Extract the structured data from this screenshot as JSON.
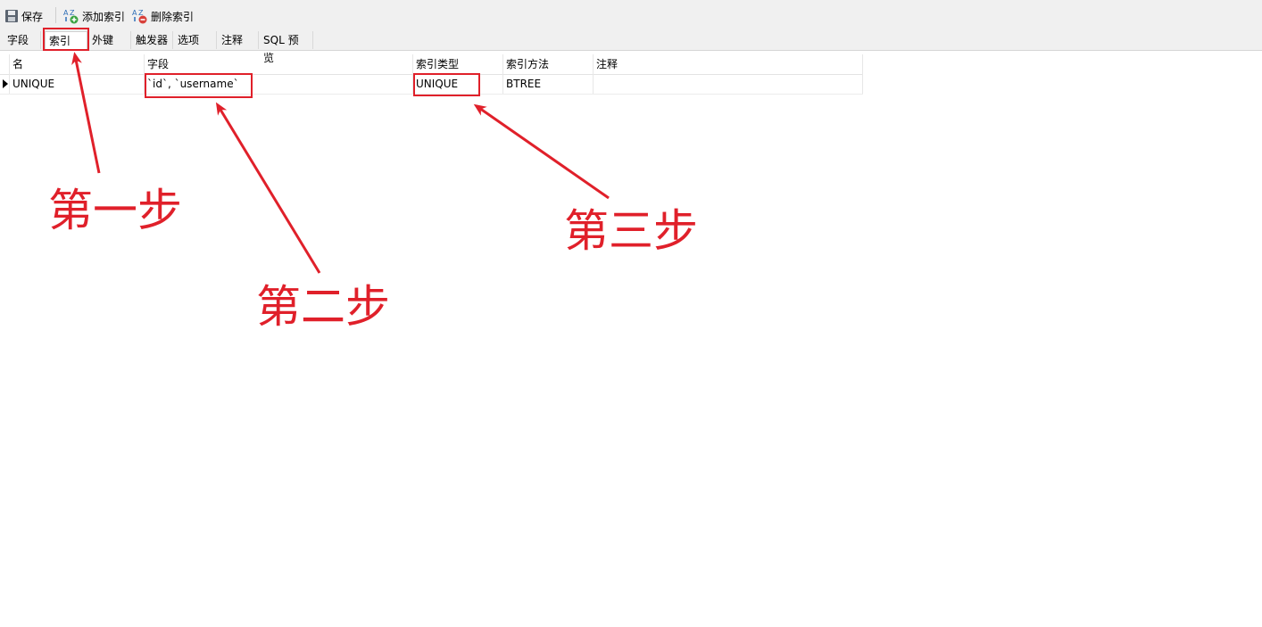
{
  "toolbar": {
    "save_label": "保存",
    "add_index_label": "添加索引",
    "delete_index_label": "删除索引"
  },
  "tabs": [
    {
      "label": "字段"
    },
    {
      "label": "索引",
      "active": true
    },
    {
      "label": "外键"
    },
    {
      "label": "触发器"
    },
    {
      "label": "选项"
    },
    {
      "label": "注释"
    },
    {
      "label": "SQL 预览"
    }
  ],
  "grid": {
    "headers": [
      "名",
      "字段",
      "索引类型",
      "索引方法",
      "注释"
    ],
    "rows": [
      [
        "UNIQUE",
        "`id`, `username`",
        "UNIQUE",
        "BTREE",
        ""
      ]
    ]
  },
  "annotations": {
    "step1": "第一步",
    "step2": "第二步",
    "step3": "第三步",
    "color": "#e0202a"
  }
}
